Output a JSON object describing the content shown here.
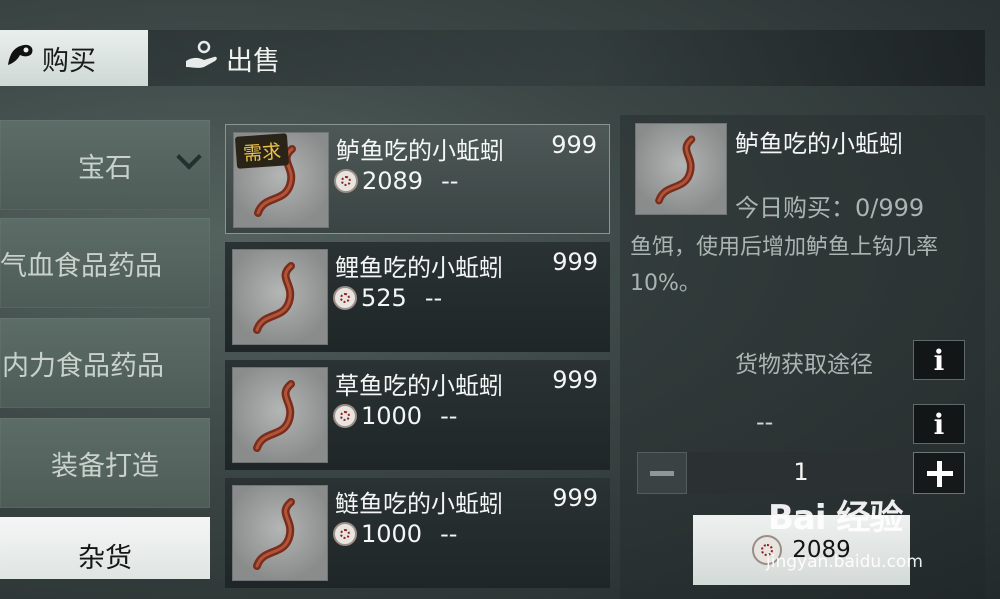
{
  "tabs": [
    {
      "label": "购买"
    },
    {
      "label": "出售"
    }
  ],
  "categories": [
    {
      "label": "宝石"
    },
    {
      "label": "气血食品药品"
    },
    {
      "label": "内力食品药品"
    },
    {
      "label": "装备打造"
    },
    {
      "label": "杂货"
    }
  ],
  "items": [
    {
      "name": "鲈鱼吃的小蚯蚓",
      "stock": "999",
      "price": "2089",
      "extra": "--",
      "badge": "需求"
    },
    {
      "name": "鲤鱼吃的小蚯蚓",
      "stock": "999",
      "price": "525",
      "extra": "--"
    },
    {
      "name": "草鱼吃的小蚯蚓",
      "stock": "999",
      "price": "1000",
      "extra": "--"
    },
    {
      "name": "鲢鱼吃的小蚯蚓",
      "stock": "999",
      "price": "1000",
      "extra": "--"
    }
  ],
  "detail": {
    "name": "鲈鱼吃的小蚯蚓",
    "daily_limit": "今日购买：0/999",
    "description": "鱼饵，使用后增加鲈鱼上钩几率10%。",
    "source_label": "货物获取途径",
    "info_glyph": "i",
    "source_value": "--",
    "quantity": "1",
    "total_price": "2089"
  },
  "watermark": {
    "logo": "Bai 经验",
    "url": "jingyan.baidu.com"
  },
  "icons": {
    "buy": "bag-icon",
    "sell": "hand-coin-icon",
    "currency": "coin-icon",
    "worm": "worm-icon"
  }
}
